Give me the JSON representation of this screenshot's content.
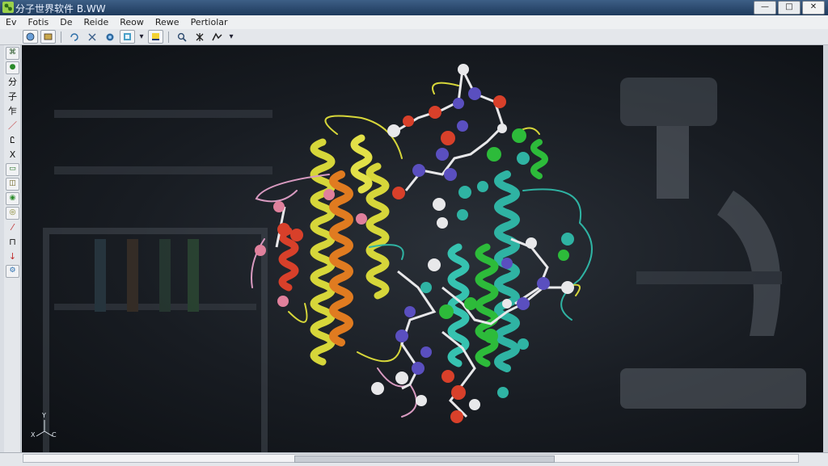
{
  "window": {
    "title": "分子世界软件 B.WW",
    "controls": {
      "minimize": "—",
      "maximize": "□",
      "close": "✕"
    }
  },
  "menu": {
    "items": [
      "Ev",
      "Fotis",
      "De",
      "Reide",
      "Reow",
      "Rewe",
      "Pertiolar"
    ]
  },
  "toolbar": {
    "buttons": [
      "open-icon",
      "save-icon",
      "rotate-icon",
      "measure-icon",
      "atom-icon",
      "view-icon",
      "highlight-icon",
      "zoom-icon",
      "select-icon",
      "mode-icon"
    ]
  },
  "toolbox": {
    "labels": [
      "分",
      "子",
      "乍",
      "Ꮭ",
      "Ⅹ",
      "⊓"
    ]
  },
  "viewport": {
    "axis": {
      "x": "X",
      "y": "Y",
      "z": "C"
    },
    "colors": {
      "yellow": "#d6d63a",
      "orange": "#e07b20",
      "teal": "#2fb3a3",
      "green": "#2dbb3a",
      "purple": "#5a4fbf",
      "red": "#d8402a",
      "pink": "#e0809c",
      "white": "#e8e8ea"
    }
  }
}
